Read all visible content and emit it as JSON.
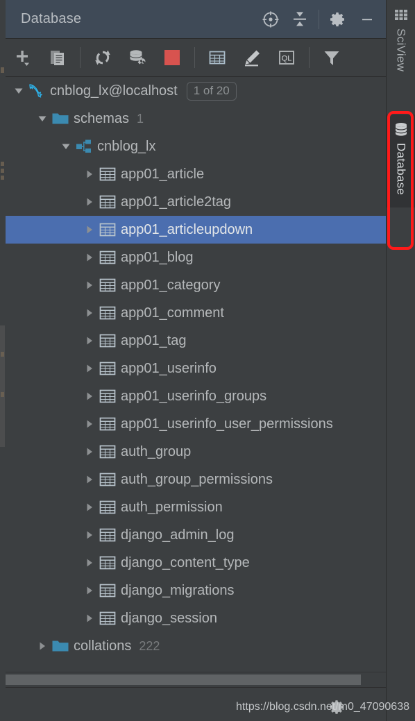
{
  "window": {
    "title": "Database",
    "actions": [
      {
        "name": "jump-to-console-icon",
        "label": "Jump to Query Console"
      },
      {
        "name": "collapse-all-icon",
        "label": "Collapse All"
      },
      {
        "name": "settings-gear-icon",
        "label": "Settings"
      },
      {
        "name": "minimize-icon",
        "label": "Hide"
      }
    ]
  },
  "toolbar": {
    "items": [
      {
        "name": "add-new-icon",
        "label": "New"
      },
      {
        "name": "duplicate-icon",
        "label": "Duplicate"
      },
      {
        "name": "refresh-icon",
        "label": "Refresh"
      },
      {
        "name": "database-tools-icon",
        "label": "Database Tools"
      },
      {
        "name": "stop-icon",
        "label": "Stop"
      },
      {
        "name": "table-editor-icon",
        "label": "Open Table Editor"
      },
      {
        "name": "modify-icon",
        "label": "Modify"
      },
      {
        "name": "query-console-icon",
        "label": "Open Query Console"
      },
      {
        "name": "filter-icon",
        "label": "Filter"
      }
    ],
    "query_console_text": "QL"
  },
  "tree": {
    "nodes": [
      {
        "depth": 0,
        "twisty": "expanded",
        "icon": "mysql-dolphin-icon",
        "label": "cnblog_lx@localhost",
        "badge": "1 of 20",
        "count": "",
        "selected": false
      },
      {
        "depth": 1,
        "twisty": "expanded",
        "icon": "folder-icon",
        "label": "schemas",
        "badge": "",
        "count": "1",
        "selected": false
      },
      {
        "depth": 2,
        "twisty": "expanded",
        "icon": "schema-icon",
        "label": "cnblog_lx",
        "badge": "",
        "count": "",
        "selected": false
      },
      {
        "depth": 3,
        "twisty": "collapsed",
        "icon": "table-icon",
        "label": "app01_article",
        "badge": "",
        "count": "",
        "selected": false
      },
      {
        "depth": 3,
        "twisty": "collapsed",
        "icon": "table-icon",
        "label": "app01_article2tag",
        "badge": "",
        "count": "",
        "selected": false
      },
      {
        "depth": 3,
        "twisty": "collapsed",
        "icon": "table-icon",
        "label": "app01_articleupdown",
        "badge": "",
        "count": "",
        "selected": true
      },
      {
        "depth": 3,
        "twisty": "collapsed",
        "icon": "table-icon",
        "label": "app01_blog",
        "badge": "",
        "count": "",
        "selected": false
      },
      {
        "depth": 3,
        "twisty": "collapsed",
        "icon": "table-icon",
        "label": "app01_category",
        "badge": "",
        "count": "",
        "selected": false
      },
      {
        "depth": 3,
        "twisty": "collapsed",
        "icon": "table-icon",
        "label": "app01_comment",
        "badge": "",
        "count": "",
        "selected": false
      },
      {
        "depth": 3,
        "twisty": "collapsed",
        "icon": "table-icon",
        "label": "app01_tag",
        "badge": "",
        "count": "",
        "selected": false
      },
      {
        "depth": 3,
        "twisty": "collapsed",
        "icon": "table-icon",
        "label": "app01_userinfo",
        "badge": "",
        "count": "",
        "selected": false
      },
      {
        "depth": 3,
        "twisty": "collapsed",
        "icon": "table-icon",
        "label": "app01_userinfo_groups",
        "badge": "",
        "count": "",
        "selected": false
      },
      {
        "depth": 3,
        "twisty": "collapsed",
        "icon": "table-icon",
        "label": "app01_userinfo_user_permissions",
        "badge": "",
        "count": "",
        "selected": false
      },
      {
        "depth": 3,
        "twisty": "collapsed",
        "icon": "table-icon",
        "label": "auth_group",
        "badge": "",
        "count": "",
        "selected": false
      },
      {
        "depth": 3,
        "twisty": "collapsed",
        "icon": "table-icon",
        "label": "auth_group_permissions",
        "badge": "",
        "count": "",
        "selected": false
      },
      {
        "depth": 3,
        "twisty": "collapsed",
        "icon": "table-icon",
        "label": "auth_permission",
        "badge": "",
        "count": "",
        "selected": false
      },
      {
        "depth": 3,
        "twisty": "collapsed",
        "icon": "table-icon",
        "label": "django_admin_log",
        "badge": "",
        "count": "",
        "selected": false
      },
      {
        "depth": 3,
        "twisty": "collapsed",
        "icon": "table-icon",
        "label": "django_content_type",
        "badge": "",
        "count": "",
        "selected": false
      },
      {
        "depth": 3,
        "twisty": "collapsed",
        "icon": "table-icon",
        "label": "django_migrations",
        "badge": "",
        "count": "",
        "selected": false
      },
      {
        "depth": 3,
        "twisty": "collapsed",
        "icon": "table-icon",
        "label": "django_session",
        "badge": "",
        "count": "",
        "selected": false
      },
      {
        "depth": 1,
        "twisty": "collapsed",
        "icon": "folder-icon",
        "label": "collations",
        "badge": "",
        "count": "222",
        "selected": false
      }
    ]
  },
  "rail": {
    "items": [
      {
        "name": "sciview",
        "label": "SciView",
        "icon": "grid-icon",
        "active": false
      },
      {
        "name": "database",
        "label": "Database",
        "icon": "database-cylinder-icon",
        "active": true
      }
    ]
  },
  "annotation": {
    "highlight_color": "#ff1a1a",
    "target": "Database"
  },
  "watermark": {
    "text": "https://blog.csdn.net/m0_47090638"
  },
  "colors": {
    "titlebar_bg": "#3f4a57",
    "panel_bg": "#3c3f41",
    "selection_blue": "#4b6eaf",
    "accent_teal": "#3b8ab0",
    "stop_red": "#d8534f",
    "text": "#b5b8ba"
  }
}
